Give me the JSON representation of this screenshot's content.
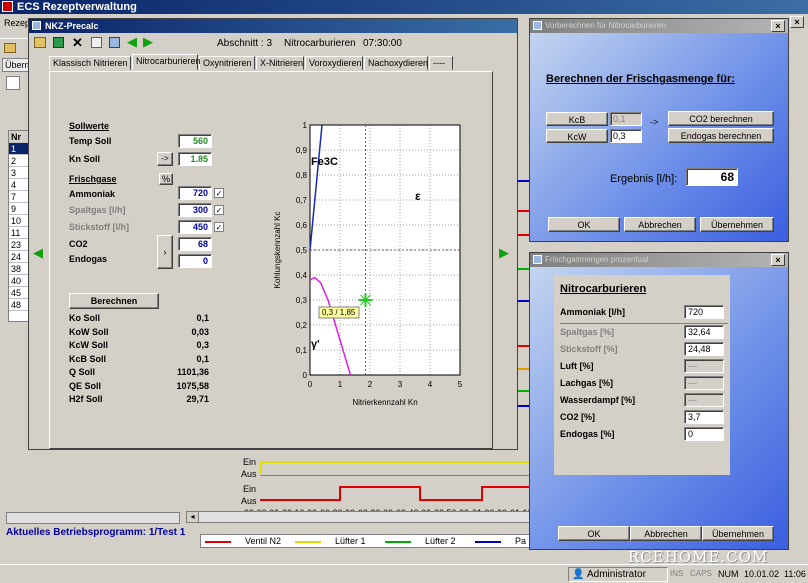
{
  "app": {
    "title": "ECS Rezeptverwaltung",
    "menu_first": "Rezep",
    "tab_first": "Überm",
    "list_header": "Nr",
    "list_rows": [
      "1",
      "2",
      "3",
      "4",
      "7",
      "9",
      "10",
      "11",
      "23",
      "24",
      "38",
      "40",
      "45",
      "48"
    ],
    "status_program": "Aktuelles Betriebsprogramm: 1/Test 1"
  },
  "precalc": {
    "title": "NKZ-Precalc",
    "abschnitt": "Abschnitt : 3",
    "process": "Nitrocarburieren",
    "time": "07:30:00",
    "tabs": [
      "Klassisch Nitrieren",
      "Nitrocarburieren",
      "Oxynitrieren",
      "X-Nitrieren",
      "Voroxydieren",
      "Nachoxydieren",
      "----"
    ],
    "active_tab": "Nitrocarburieren",
    "sollwerte_heading": "Sollwerte",
    "temp_label": "Temp Soll",
    "temp_value": "560",
    "kn_label": "Kn Soll",
    "kn_arrow": "->",
    "kn_value": "1.85",
    "frischgase_heading": "Frischgase",
    "pct_label": "%",
    "ammoniak_label": "Ammoniak",
    "ammoniak_value": "720",
    "spaltgas_label": "Spaltgas [l/h]",
    "spaltgas_value": "300",
    "stickstoff_label": "Stickstoff [l/h]",
    "stickstoff_value": "450",
    "check_mark": "✓",
    "co2_label": "CO2",
    "co2_value": "68",
    "endogas_label": "Endogas",
    "endogas_value": "0",
    "berechnen": "Berechnen",
    "results": [
      {
        "label": "Ko Soll",
        "value": "0,1"
      },
      {
        "label": "KoW Soll",
        "value": "0,03"
      },
      {
        "label": "KcW Soll",
        "value": "0,3"
      },
      {
        "label": "KcB Soll",
        "value": "0,1"
      },
      {
        "label": "Q Soll",
        "value": "1101,36"
      },
      {
        "label": "QE Soll",
        "value": "1075,58"
      },
      {
        "label": "H2f Soll",
        "value": "29,71"
      }
    ]
  },
  "chart_data": {
    "type": "line",
    "xlabel": "Nitrierkennzahl Kn",
    "ylabel": "Kohlungskennzahl Kc",
    "xlim": [
      0,
      5
    ],
    "ylim": [
      0,
      1
    ],
    "x_ticks": [
      "0",
      "1",
      "2",
      "3",
      "4",
      "5"
    ],
    "y_ticks": [
      "0",
      "0,1",
      "0,2",
      "0,3",
      "0,4",
      "0,5",
      "0,6",
      "0,7",
      "0,8",
      "0,9",
      "1"
    ],
    "grid": true,
    "annotations": [
      {
        "text": "Fe3C",
        "x": 0.0,
        "y": 0.84
      },
      {
        "text": "ε",
        "x": 3.5,
        "y": 0.7
      },
      {
        "text": "γ'",
        "x": 0.0,
        "y": 0.11
      },
      {
        "text": "0,3 / 1,85",
        "x": 0.4,
        "y": 0.24
      }
    ],
    "series": [
      {
        "color": "#1a2ab8",
        "points": [
          [
            0,
            0.5
          ],
          [
            0.4,
            1.0
          ]
        ]
      },
      {
        "color": "#e020e0",
        "points": [
          [
            0,
            0.38
          ],
          [
            0.15,
            0.39
          ],
          [
            0.35,
            0.37
          ],
          [
            0.6,
            0.3
          ],
          [
            0.9,
            0.18
          ],
          [
            1.2,
            0.06
          ],
          [
            1.35,
            0.0
          ]
        ]
      }
    ],
    "marker": {
      "x": 1.85,
      "y": 0.3,
      "color": "#22cc22"
    },
    "crosshair": {
      "x": 1.85,
      "y": 0.3
    }
  },
  "vorber": {
    "title": "Vorberechnen für Nitrocarburieren",
    "heading": "Berechnen der Frischgasmenge für:",
    "kcb_label": "KcB",
    "kcb_value": "0,1",
    "kcw_label": "KcW",
    "kcw_value": "0,3",
    "arrow": "->",
    "co2_button": "CO2 berechnen",
    "endogas_button": "Endogas berechnen",
    "result_label": "Ergebnis [l/h]:",
    "result_value": "68",
    "ok": "OK",
    "cancel": "Abbrechen",
    "apply": "Übernehmen"
  },
  "prozent": {
    "title": "Frischgasmengen prozentual",
    "heading": "Nitrocarburieren",
    "rows": [
      {
        "label": "Ammoniak [l/h]",
        "value": "720",
        "gray": false,
        "dis": false
      },
      {
        "label": "Spaltgas [%]",
        "value": "32,64",
        "gray": true,
        "dis": false
      },
      {
        "label": "Stickstoff [%]",
        "value": "24,48",
        "gray": true,
        "dis": false
      },
      {
        "label": "Luft [%]",
        "value": "---",
        "gray": false,
        "dis": true
      },
      {
        "label": "Lachgas [%]",
        "value": "---",
        "gray": false,
        "dis": true
      },
      {
        "label": "Wasserdampf [%]",
        "value": "---",
        "gray": false,
        "dis": true
      },
      {
        "label": "CO2 [%]",
        "value": "3,7",
        "gray": false,
        "dis": false
      },
      {
        "label": "Endogas [%]",
        "value": "0",
        "gray": false,
        "dis": false
      }
    ],
    "ok": "OK",
    "cancel": "Abbrechen",
    "apply": "Übernehmen"
  },
  "timeline": {
    "labels": [
      "Ein",
      "Aus",
      "Ein",
      "Aus"
    ],
    "times": [
      "00:00:00",
      "00:10:00",
      "00:20:00",
      "00:30:00",
      "00:40:00",
      "00:50:00",
      "01:00:00",
      "01:10:00"
    ],
    "legend": [
      {
        "name": "Ventil N2",
        "color": "#e00000"
      },
      {
        "name": "Lüfter 1",
        "color": "#e0e000"
      },
      {
        "name": "Lüfter 2",
        "color": "#00b000"
      },
      {
        "name": "Pa",
        "color": "#0000c0"
      }
    ]
  },
  "taskbar": {
    "user": "Administrator",
    "ind1": "INS",
    "ind2": "CAPS",
    "ind3": "NUM",
    "date": "10.01.02",
    "time": "11:06"
  },
  "watermark": "RCEHOME.COM"
}
